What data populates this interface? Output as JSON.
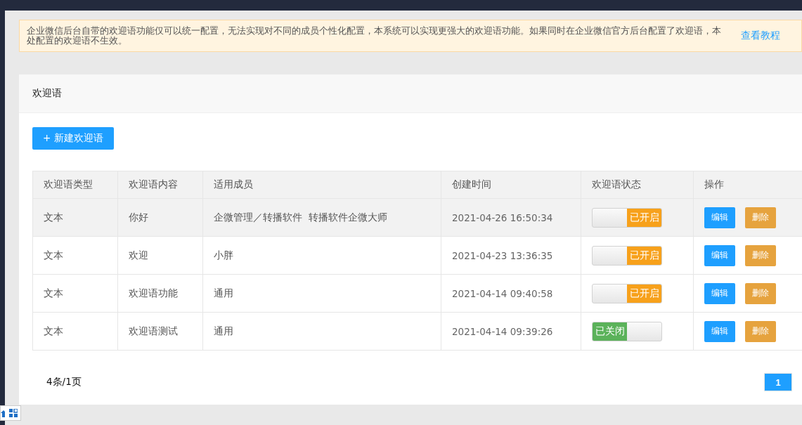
{
  "notice": {
    "text": "企业微信后台自带的欢迎语功能仅可以统一配置，无法实现对不同的成员个性化配置，本系统可以实现更强大的欢迎语功能。如果同时在企业微信官方后台配置了欢迎语，本处配置的欢迎语不生效。",
    "link": "查看教程"
  },
  "card": {
    "title": "欢迎语",
    "new_button": "+ 新建欢迎语"
  },
  "table": {
    "columns": [
      "欢迎语类型",
      "欢迎语内容",
      "适用成员",
      "创建时间",
      "欢迎语状态",
      "操作"
    ],
    "rows": [
      {
        "type": "文本",
        "content": "你好",
        "members": "企微管理／转播软件  转播软件企微大师",
        "created": "2021-04-26 16:50:34",
        "status": {
          "on": true,
          "label": "已开启"
        },
        "edit": "编辑",
        "delete": "删除",
        "selected": true
      },
      {
        "type": "文本",
        "content": "欢迎",
        "members": "小胖",
        "created": "2021-04-23 13:36:35",
        "status": {
          "on": true,
          "label": "已开启"
        },
        "edit": "编辑",
        "delete": "删除",
        "selected": false
      },
      {
        "type": "文本",
        "content": "欢迎语功能",
        "members": "通用",
        "created": "2021-04-14 09:40:58",
        "status": {
          "on": true,
          "label": "已开启"
        },
        "edit": "编辑",
        "delete": "删除",
        "selected": false
      },
      {
        "type": "文本",
        "content": "欢迎语测试",
        "members": "通用",
        "created": "2021-04-14 09:39:26",
        "status": {
          "on": false,
          "label": "已关闭"
        },
        "edit": "编辑",
        "delete": "删除",
        "selected": false
      }
    ]
  },
  "pagination": {
    "summary": "4条/1页",
    "pages": [
      {
        "label": "1",
        "selected": true
      }
    ]
  }
}
